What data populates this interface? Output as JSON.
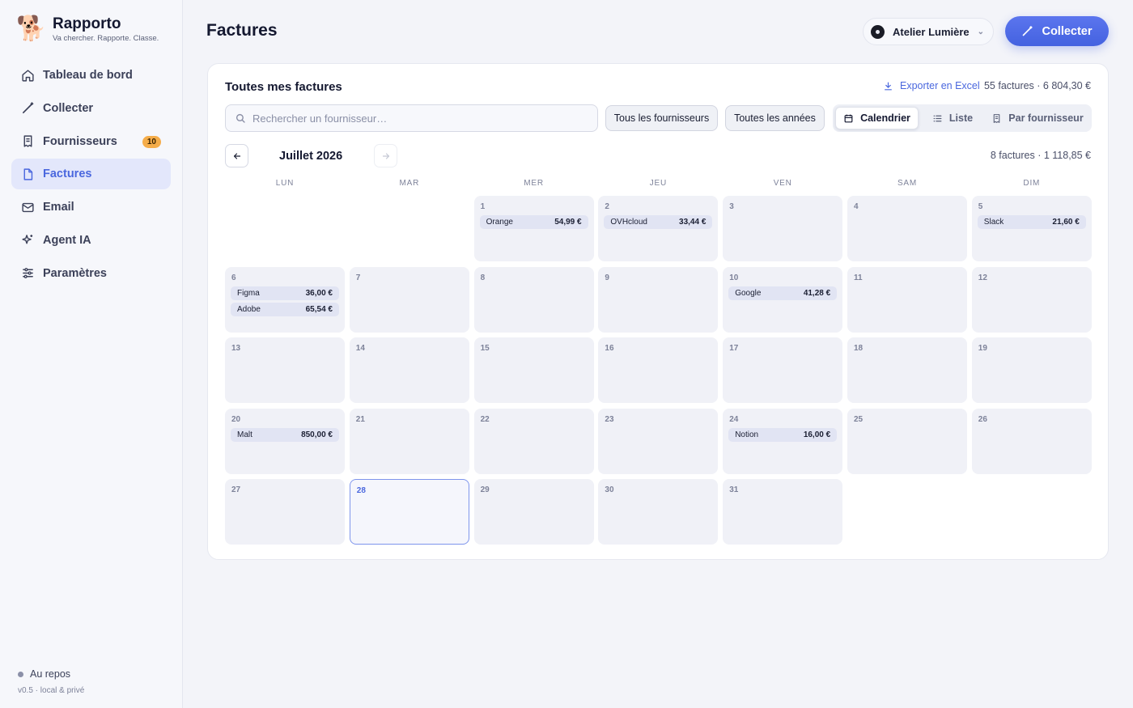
{
  "brand": {
    "name": "Rapporto",
    "tagline": "Va chercher. Rapporte. Classe.",
    "logo": "🐕"
  },
  "sidebar": {
    "items": [
      {
        "label": "Tableau de bord",
        "icon": "home-icon"
      },
      {
        "label": "Collecter",
        "icon": "wand-icon"
      },
      {
        "label": "Fournisseurs",
        "icon": "receipt-icon",
        "badge": "10"
      },
      {
        "label": "Factures",
        "icon": "file-icon",
        "active": true
      },
      {
        "label": "Email",
        "icon": "mail-icon"
      },
      {
        "label": "Agent IA",
        "icon": "sparkle-icon"
      },
      {
        "label": "Paramètres",
        "icon": "sliders-icon"
      }
    ],
    "status": "Au repos",
    "version": "v0.5 · local & privé"
  },
  "header": {
    "title": "Factures",
    "workspace": "Atelier Lumière",
    "collect_label": "Collecter"
  },
  "card": {
    "title": "Toutes mes factures",
    "export_label": "Exporter en Excel",
    "summary": "55 factures · 6 804,30 €",
    "search_placeholder": "Rechercher un fournisseur…",
    "filter_suppliers": "Tous les fournisseurs",
    "filter_years": "Toutes les années",
    "views": [
      "Calendrier",
      "Liste",
      "Par fournisseur"
    ],
    "active_view": "Calendrier"
  },
  "calendar": {
    "month_label": "Juillet 2026",
    "month_summary": "8 factures · 1 118,85 €",
    "weekdays": [
      "LUN",
      "MAR",
      "MER",
      "JEU",
      "VEN",
      "SAM",
      "DIM"
    ],
    "today": "28",
    "days": [
      {
        "day": "1",
        "invoices": [
          {
            "vendor": "Orange",
            "amount": "54,99 €"
          }
        ]
      },
      {
        "day": "2",
        "invoices": [
          {
            "vendor": "OVHcloud",
            "amount": "33,44 €"
          }
        ]
      },
      {
        "day": "3",
        "invoices": []
      },
      {
        "day": "4",
        "invoices": []
      },
      {
        "day": "5",
        "invoices": [
          {
            "vendor": "Slack",
            "amount": "21,60 €"
          }
        ]
      },
      {
        "day": "6",
        "invoices": [
          {
            "vendor": "Figma",
            "amount": "36,00 €"
          },
          {
            "vendor": "Adobe",
            "amount": "65,54 €"
          }
        ]
      },
      {
        "day": "7",
        "invoices": []
      },
      {
        "day": "8",
        "invoices": []
      },
      {
        "day": "9",
        "invoices": []
      },
      {
        "day": "10",
        "invoices": [
          {
            "vendor": "Google",
            "amount": "41,28 €"
          }
        ]
      },
      {
        "day": "11",
        "invoices": []
      },
      {
        "day": "12",
        "invoices": []
      },
      {
        "day": "13",
        "invoices": []
      },
      {
        "day": "14",
        "invoices": []
      },
      {
        "day": "15",
        "invoices": []
      },
      {
        "day": "16",
        "invoices": []
      },
      {
        "day": "17",
        "invoices": []
      },
      {
        "day": "18",
        "invoices": []
      },
      {
        "day": "19",
        "invoices": []
      },
      {
        "day": "20",
        "invoices": [
          {
            "vendor": "Malt",
            "amount": "850,00 €"
          }
        ]
      },
      {
        "day": "21",
        "invoices": []
      },
      {
        "day": "22",
        "invoices": []
      },
      {
        "day": "23",
        "invoices": []
      },
      {
        "day": "24",
        "invoices": [
          {
            "vendor": "Notion",
            "amount": "16,00 €"
          }
        ]
      },
      {
        "day": "25",
        "invoices": []
      },
      {
        "day": "26",
        "invoices": []
      },
      {
        "day": "27",
        "invoices": []
      },
      {
        "day": "28",
        "invoices": []
      },
      {
        "day": "29",
        "invoices": []
      },
      {
        "day": "30",
        "invoices": []
      },
      {
        "day": "31",
        "invoices": []
      }
    ]
  },
  "colors": {
    "accent": "#4a67de",
    "badge": "#f5ad4a",
    "cell": "#f0f1f7",
    "chip": "#e1e4f3"
  }
}
